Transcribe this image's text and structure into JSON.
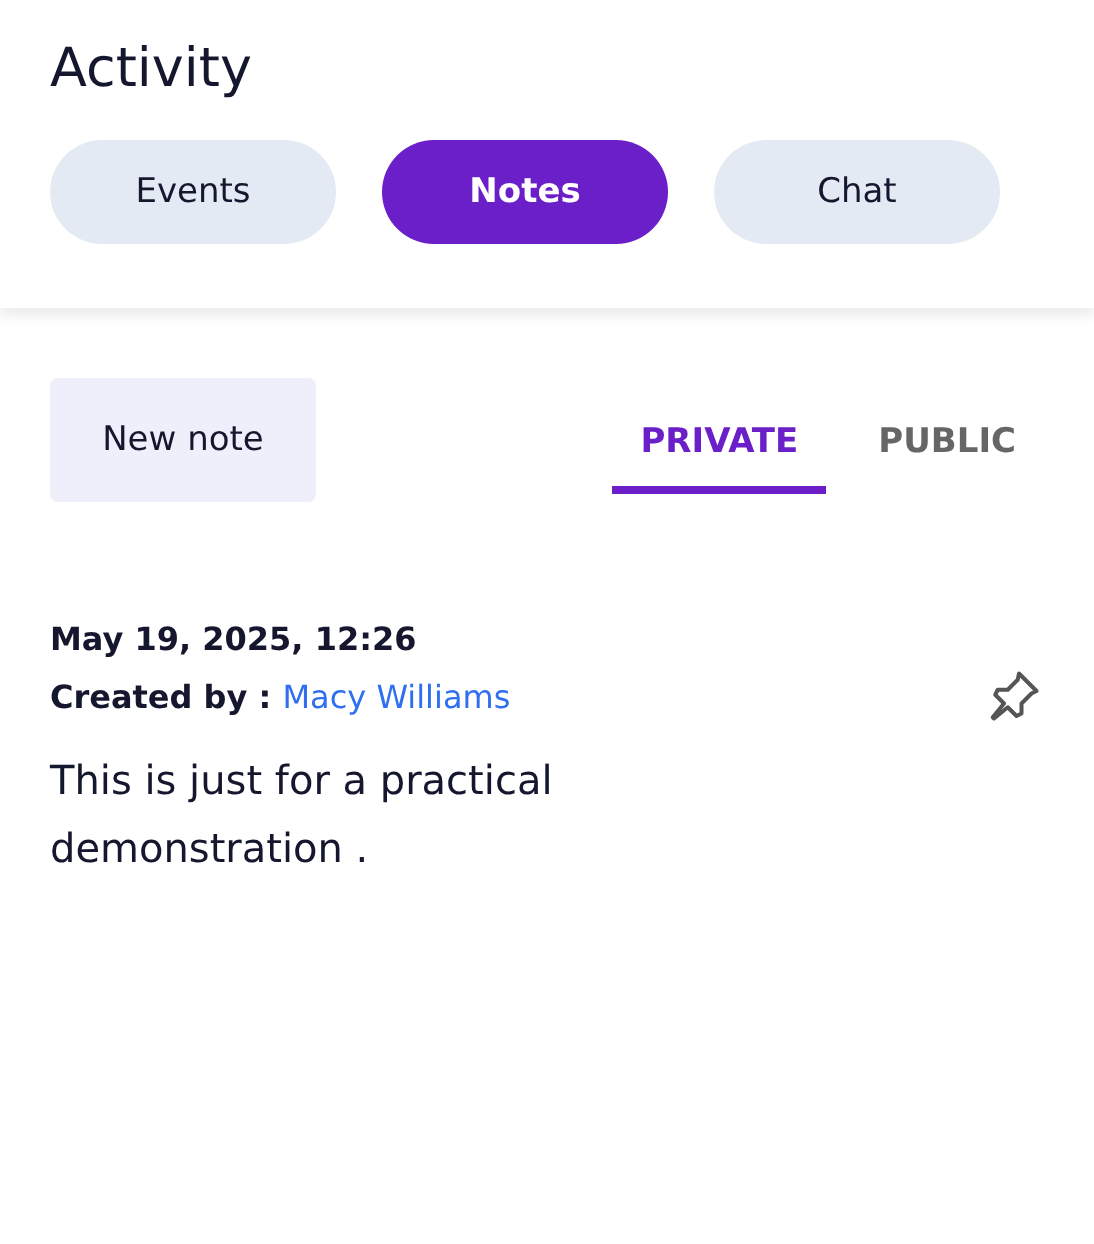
{
  "header": {
    "title": "Activity"
  },
  "tabs": [
    {
      "label": "Events",
      "selected": false
    },
    {
      "label": "Notes",
      "selected": true
    },
    {
      "label": "Chat",
      "selected": false
    }
  ],
  "toolbar": {
    "new_note": "New note",
    "visibility_tabs": [
      {
        "label": "PRIVATE",
        "selected": true
      },
      {
        "label": "PUBLIC",
        "selected": false
      }
    ]
  },
  "notes": [
    {
      "date": "May 19, 2025, 12:26",
      "created_by_label": "Created by :",
      "author": "Macy Williams",
      "text": "This is just for a practical demonstration .",
      "pinned": false
    }
  ]
}
